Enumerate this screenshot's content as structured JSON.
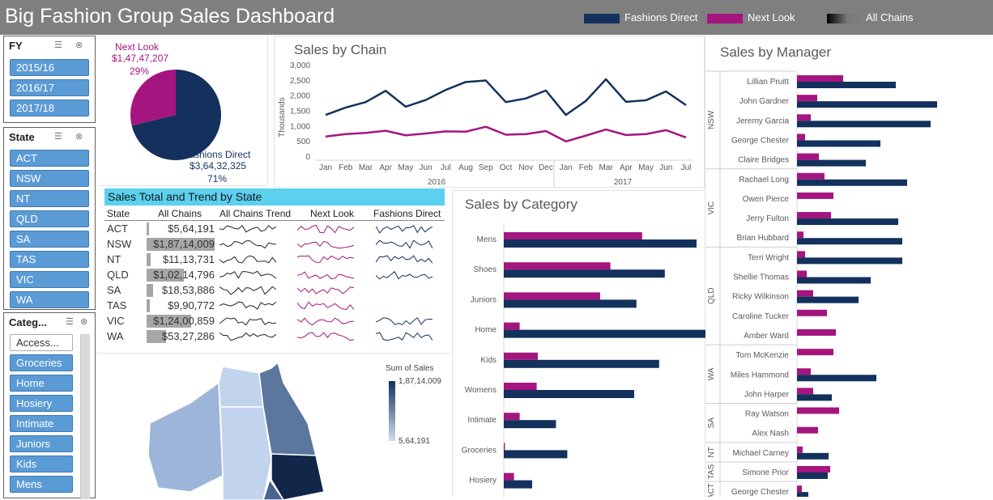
{
  "title": "Big Fashion Group Sales Dashboard",
  "colors": {
    "fashions_direct": "#13315c",
    "next_look": "#a5157f",
    "header_bg": "#7f7f7f",
    "slicer_btn": "#5b9bd5",
    "table_header": "#5bd0ef"
  },
  "header_legend": {
    "fashions_direct": "Fashions Direct",
    "next_look": "Next Look",
    "all_chains": "All Chains"
  },
  "slicers": {
    "fy": {
      "title": "FY",
      "items": [
        "2015/16",
        "2016/17",
        "2017/18"
      ]
    },
    "state": {
      "title": "State",
      "items": [
        "ACT",
        "NSW",
        "NT",
        "QLD",
        "SA",
        "TAS",
        "VIC",
        "WA"
      ]
    },
    "category": {
      "title": "Categ...",
      "items": [
        "Access...",
        "Groceries",
        "Home",
        "Hosiery",
        "Intimate",
        "Juniors",
        "Kids",
        "Mens"
      ]
    }
  },
  "pie": {
    "next_look": {
      "label": "Next Look",
      "value": "$1,47,47,207",
      "pct": "29%"
    },
    "fashions_direct": {
      "label": "Fashions Direct",
      "value": "$3,64,32,325",
      "pct": "71%"
    }
  },
  "chart_data": [
    {
      "type": "pie",
      "title": "",
      "slices": [
        {
          "name": "Next Look",
          "value": 14747207,
          "pct": 29
        },
        {
          "name": "Fashions Direct",
          "value": 36432325,
          "pct": 71
        }
      ]
    },
    {
      "type": "line",
      "title": "Sales by Chain",
      "ylabel": "Thousands",
      "ylim": [
        0,
        3000
      ],
      "yticks": [
        "0",
        "500",
        "1,000",
        "1,500",
        "2,000",
        "2,500",
        "3,000"
      ],
      "categories": [
        "Jan",
        "Feb",
        "Mar",
        "Apr",
        "May",
        "Jun",
        "Jul",
        "Aug",
        "Sep",
        "Oct",
        "Nov",
        "Dec",
        "Jan",
        "Feb",
        "Mar",
        "Apr",
        "May",
        "Jun",
        "Jul"
      ],
      "groups": [
        {
          "label": "2016"
        },
        {
          "label": "2017"
        }
      ],
      "series": [
        {
          "name": "Fashions Direct",
          "values": [
            1380,
            1620,
            1800,
            2170,
            1650,
            1870,
            2200,
            2460,
            2510,
            1800,
            1920,
            2180,
            1380,
            1840,
            2550,
            1810,
            1860,
            2150,
            1700
          ]
        },
        {
          "name": "Next Look",
          "values": [
            670,
            750,
            790,
            860,
            710,
            770,
            840,
            830,
            990,
            730,
            750,
            850,
            510,
            700,
            900,
            720,
            750,
            880,
            640
          ]
        }
      ]
    },
    {
      "type": "bar",
      "title": "Sales by Category",
      "categories": [
        "Mens",
        "Shoes",
        "Juniors",
        "Home",
        "Kids",
        "Womens",
        "Intimate",
        "Groceries",
        "Hosiery"
      ],
      "series": [
        {
          "name": "Next Look",
          "values": [
            122,
            94,
            85,
            14,
            30,
            29,
            14,
            1,
            9
          ]
        },
        {
          "name": "Fashions Direct",
          "values": [
            170,
            142,
            117,
            184,
            137,
            115,
            46,
            56,
            25
          ]
        }
      ]
    },
    {
      "type": "bar",
      "title": "Sales by Manager",
      "groups": [
        "NSW",
        "VIC",
        "QLD",
        "WA",
        "SA",
        "NT",
        "TAS",
        "ACT"
      ],
      "categories": [
        "Lillian Pruitt",
        "John Gardner",
        "Jeremy Garcia",
        "George Chester",
        "Claire Bridges",
        "Rachael Long",
        "Owen Pierce",
        "Jerry Fulton",
        "Brian Hubbard",
        "Terri Wright",
        "Shellie Thomas",
        "Ricky Wilkinson",
        "Caroline Tucker",
        "Amber Ward",
        "Tom McKenzie",
        "Miles Hammond",
        "John Harper",
        "Ray Watson",
        "Alex Nash",
        "Michael Carney",
        "Simone Prior",
        "George Chester"
      ],
      "series": [
        {
          "name": "Next Look",
          "values": [
            57,
            25,
            17,
            10,
            27,
            34,
            45,
            42,
            8,
            10,
            12,
            20,
            37,
            48,
            45,
            17,
            20,
            52,
            26,
            7,
            41,
            6
          ]
        },
        {
          "name": "Fashions Direct",
          "values": [
            122,
            173,
            165,
            103,
            85,
            136,
            0,
            125,
            130,
            130,
            91,
            76,
            0,
            0,
            0,
            98,
            43,
            0,
            0,
            39,
            38,
            14
          ]
        }
      ]
    }
  ],
  "line_chart": {
    "year1": "2016",
    "year2": "2017"
  },
  "state_table": {
    "title": "Sales Total and Trend by State",
    "headers": [
      "State",
      "All Chains",
      "All Chains Trend",
      "Next Look",
      "Fashions Direct"
    ],
    "rows": [
      {
        "state": "ACT",
        "total": "$5,64,191",
        "bar": 0.03
      },
      {
        "state": "NSW",
        "total": "$1,87,14,009",
        "bar": 1.0
      },
      {
        "state": "NT",
        "total": "$11,13,731",
        "bar": 0.06
      },
      {
        "state": "QLD",
        "total": "$1,02,14,796",
        "bar": 0.55
      },
      {
        "state": "SA",
        "total": "$18,53,886",
        "bar": 0.1
      },
      {
        "state": "TAS",
        "total": "$9,90,772",
        "bar": 0.05
      },
      {
        "state": "VIC",
        "total": "$1,24,00,859",
        "bar": 0.66
      },
      {
        "state": "WA",
        "total": "$53,27,286",
        "bar": 0.28
      }
    ]
  },
  "map": {
    "legend_title": "Sum of Sales",
    "max": "1,87,14,009",
    "min": "5,64,191"
  }
}
